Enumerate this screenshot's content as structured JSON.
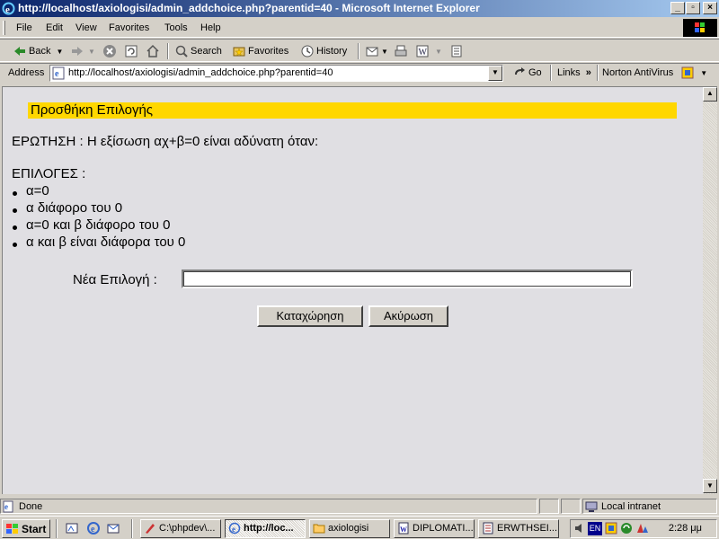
{
  "window": {
    "title": "http://localhost/axiologisi/admin_addchoice.php?parentid=40 - Microsoft Internet Explorer"
  },
  "menu": [
    "File",
    "Edit",
    "View",
    "Favorites",
    "Tools",
    "Help"
  ],
  "toolbar": {
    "back": "Back",
    "search": "Search",
    "favorites": "Favorites",
    "history": "History"
  },
  "address": {
    "label": "Address",
    "url": "http://localhost/axiologisi/admin_addchoice.php?parentid=40",
    "go": "Go",
    "links": "Links",
    "antivirus": "Norton AntiVirus"
  },
  "page": {
    "heading": "Προσθήκη Επιλογής",
    "question": "ΕΡΩΤΗΣΗ : Η εξίσωση αχ+β=0 είναι αδύνατη όταν:",
    "choices_label": "ΕΠΙΛΟΓΕΣ :",
    "choices": [
      "α=0",
      "α διάφορο του 0",
      "α=0 και β διάφορο του 0",
      "α και β είναι διάφορα του 0"
    ],
    "new_choice_label": "Νέα Επιλογή :",
    "new_choice_value": "",
    "submit_label": "Καταχώρηση",
    "cancel_label": "Ακύρωση"
  },
  "status": {
    "text": "Done",
    "zone": "Local intranet"
  },
  "taskbar": {
    "start": "Start",
    "tasks": [
      "C:\\phpdev\\...",
      "http://loc...",
      "axiologisi",
      "DIPLOMATI...",
      "ERWTHSEI..."
    ],
    "active_task": 1,
    "lang": "EN",
    "clock": "2:28 μμ"
  },
  "colors": {
    "heading_bg": "#ffd700",
    "titlebar": "#0a246a",
    "content_bg": "#e0dfe3"
  }
}
